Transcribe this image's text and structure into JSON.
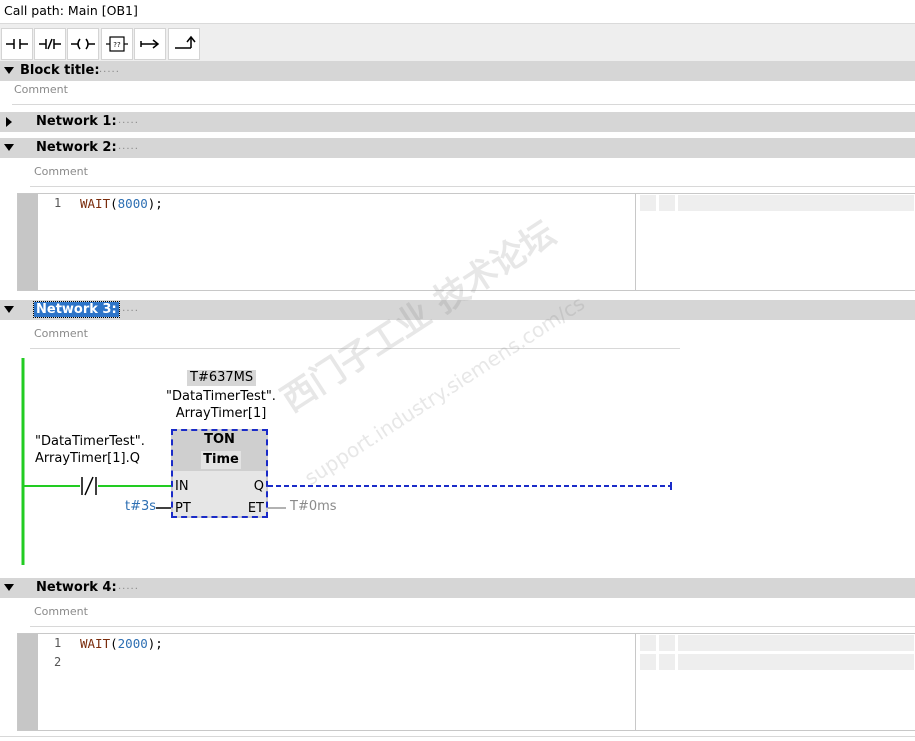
{
  "callpath": "Call path: Main [OB1]",
  "block": {
    "title": "Block title:",
    "dots": ".....",
    "comment": "Comment"
  },
  "networks": [
    {
      "title": "Network 1:",
      "dots": "....."
    },
    {
      "title": "Network 2:",
      "dots": ".....",
      "comment": "Comment",
      "code": [
        {
          "num": "1",
          "kw": "WAIT",
          "open": "(",
          "arg": "8000",
          "close": ");"
        }
      ]
    },
    {
      "title": "Network 3:",
      "dots": ".....",
      "comment": "Comment",
      "contact_tag": [
        "\"DataTimerTest\".",
        "ArrayTimer[1].Q"
      ],
      "timer_value": "T#637MS",
      "timer_tag": [
        "\"DataTimerTest\".",
        "ArrayTimer[1]"
      ],
      "timer_type": "TON",
      "timer_subtype": "Time",
      "pin_in": "IN",
      "pin_q": "Q",
      "pin_pt": "PT",
      "pin_et": "ET",
      "pt_value": "t#3s",
      "et_value": "T#0ms"
    },
    {
      "title": "Network 4:",
      "dots": ".....",
      "comment": "Comment",
      "code": [
        {
          "num": "1",
          "kw": "WAIT",
          "open": "(",
          "arg": "2000",
          "close": ");"
        },
        {
          "num": "2"
        }
      ]
    }
  ],
  "watermark": {
    "cn": "西门子工业 技术论坛",
    "url": "support.industry.siemens.com/cs"
  }
}
